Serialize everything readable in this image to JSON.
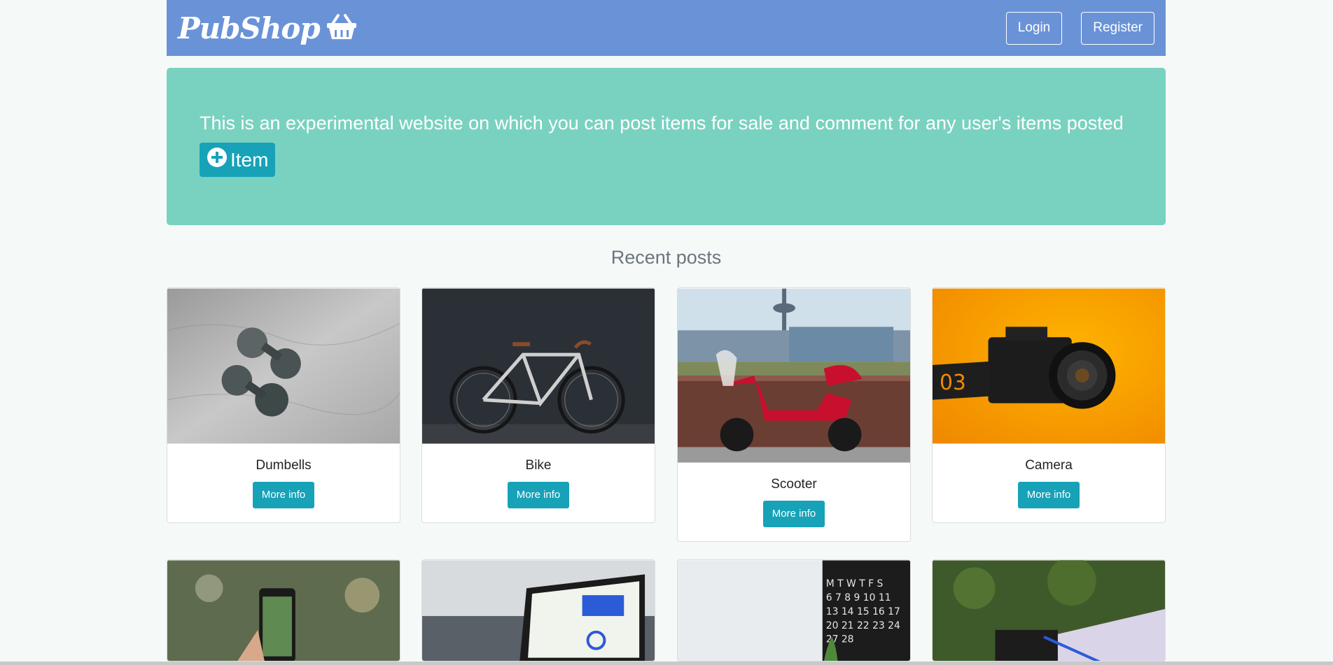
{
  "navbar": {
    "brand": "PubShop",
    "brand_icon": "basket-icon",
    "login_label": "Login",
    "register_label": "Register"
  },
  "jumbotron": {
    "text": "This is an experimental website on which you can post items for sale and comment for any user's items posted",
    "add_button_label": "Item",
    "add_button_icon": "plus-circle-icon"
  },
  "recent": {
    "title": "Recent posts",
    "more_info_label": "More info",
    "cards": [
      {
        "title": "Dumbells"
      },
      {
        "title": "Bike"
      },
      {
        "title": "Scooter"
      },
      {
        "title": "Camera"
      }
    ]
  },
  "colors": {
    "navbar": "#6a93d7",
    "jumbotron": "#79d2c0",
    "primary_button": "#17a2b8"
  }
}
